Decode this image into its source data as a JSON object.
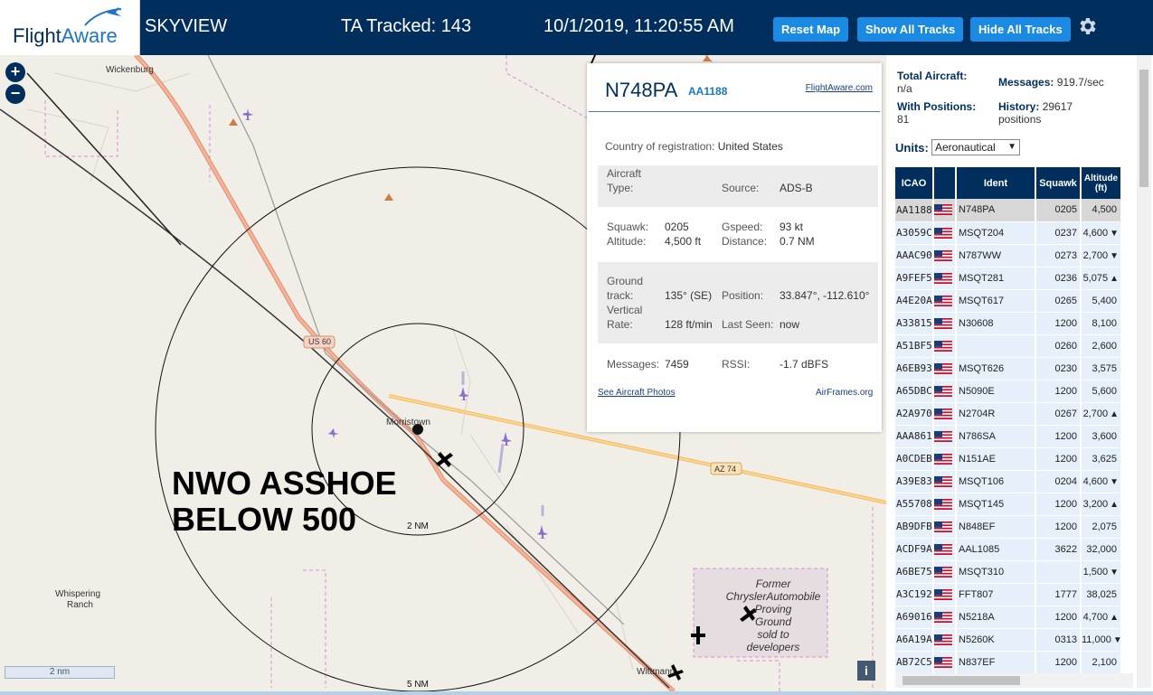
{
  "header": {
    "logo_flight": "Flight",
    "logo_aware": "Aware",
    "title": "SKYVIEW",
    "tracked": "TA Tracked: 143",
    "datetime": "10/1/2019, 11:20:55 AM",
    "btn_reset": "Reset Map",
    "btn_show": "Show All Tracks",
    "btn_hide": "Hide All Tracks"
  },
  "map": {
    "zoom_in": "+",
    "zoom_out": "−",
    "scale": "2 nm",
    "info": "i",
    "labels": {
      "wickenburg": "Wickenburg",
      "us60": "US 60",
      "az74": "AZ 74",
      "morristown": "Morristown",
      "whispering1": "Whispering",
      "whispering2": "Ranch",
      "wittmann": "Wittmann",
      "ring2": "2 NM",
      "ring5": "5 NM"
    },
    "overlay_line1": "NWO ASSHOE",
    "overlay_line2": "BELOW 500",
    "chrysler_lines": [
      "Former",
      "ChryslerAutomobile",
      "Proving",
      "Ground",
      "sold to",
      "developers"
    ]
  },
  "popup": {
    "registration": "N748PA",
    "ident": "AA1188",
    "fa_link": "FlightAware.com",
    "country_label": "Country of registration:",
    "country": "United States",
    "aircraft_label": "Aircraft",
    "type_label": "Type:",
    "source_label": "Source:",
    "source": "ADS-B",
    "squawk_label": "Squawk:",
    "squawk": "0205",
    "altitude_label": "Altitude:",
    "altitude": "4,500 ft",
    "gspeed_label": "Gspeed:",
    "gspeed": "93 kt",
    "distance_label": "Distance:",
    "distance": "0.7 NM",
    "ground_label": "Ground",
    "track_label": "track:",
    "track": "135° (SE)",
    "vertical_label": "Vertical",
    "rate_label": "Rate:",
    "rate": "128 ft/min",
    "position_label": "Position:",
    "position": "33.847°, -112.610°",
    "lastseen_label": "Last Seen:",
    "lastseen": "now",
    "messages_label": "Messages:",
    "messages": "7459",
    "rssi_label": "RSSI:",
    "rssi": "-1.7 dBFS",
    "photos_link": "See Aircraft Photos",
    "airframes_link": "AirFrames.org"
  },
  "sidebar": {
    "total_label": "Total Aircraft:",
    "total": "n/a",
    "messages_label": "Messages:",
    "messages": "919.7/sec",
    "withpos_label": "With Positions:",
    "withpos": "81",
    "history_label": "History:",
    "history": "29617",
    "history_unit": "positions",
    "units_label": "Units:",
    "units": "Aeronautical",
    "columns": [
      "ICAO",
      "",
      "Ident",
      "Squawk",
      "Altitude (ft)",
      ""
    ],
    "rows": [
      {
        "icao": "AA1188",
        "ident": "N748PA",
        "squawk": "0205",
        "alt": "4,500",
        "trend": ""
      },
      {
        "icao": "A3059C",
        "ident": "MSQT204",
        "squawk": "0237",
        "alt": "4,600",
        "trend": "▼"
      },
      {
        "icao": "AAAC90",
        "ident": "N787WW",
        "squawk": "0273",
        "alt": "2,700",
        "trend": "▼"
      },
      {
        "icao": "A9FEF5",
        "ident": "MSQT281",
        "squawk": "0236",
        "alt": "5,075",
        "trend": "▲"
      },
      {
        "icao": "A4E20A",
        "ident": "MSQT617",
        "squawk": "0265",
        "alt": "5,400",
        "trend": ""
      },
      {
        "icao": "A33815",
        "ident": "N30608",
        "squawk": "1200",
        "alt": "8,100",
        "trend": ""
      },
      {
        "icao": "A51BF5",
        "ident": "",
        "squawk": "0260",
        "alt": "2,600",
        "trend": ""
      },
      {
        "icao": "A6EB93",
        "ident": "MSQT626",
        "squawk": "0230",
        "alt": "3,575",
        "trend": ""
      },
      {
        "icao": "A65DBC",
        "ident": "N5090E",
        "squawk": "1200",
        "alt": "5,600",
        "trend": ""
      },
      {
        "icao": "A2A970",
        "ident": "N2704R",
        "squawk": "0267",
        "alt": "2,700",
        "trend": "▲"
      },
      {
        "icao": "AAA861",
        "ident": "N786SA",
        "squawk": "1200",
        "alt": "3,600",
        "trend": ""
      },
      {
        "icao": "A0CDEB",
        "ident": "N151AE",
        "squawk": "1200",
        "alt": "3,625",
        "trend": ""
      },
      {
        "icao": "A39E83",
        "ident": "MSQT106",
        "squawk": "0204",
        "alt": "4,600",
        "trend": "▼"
      },
      {
        "icao": "A55708",
        "ident": "MSQT145",
        "squawk": "1200",
        "alt": "3,200",
        "trend": "▲"
      },
      {
        "icao": "AB9DFB",
        "ident": "N848EF",
        "squawk": "1200",
        "alt": "2,075",
        "trend": ""
      },
      {
        "icao": "ACDF9A",
        "ident": "AAL1085",
        "squawk": "3622",
        "alt": "32,000",
        "trend": ""
      },
      {
        "icao": "A6BE75",
        "ident": "MSQT310",
        "squawk": "",
        "alt": "1,500",
        "trend": "▼"
      },
      {
        "icao": "A3C192",
        "ident": "FFT807",
        "squawk": "1777",
        "alt": "38,025",
        "trend": ""
      },
      {
        "icao": "A69016",
        "ident": "N5218A",
        "squawk": "1200",
        "alt": "4,700",
        "trend": "▲"
      },
      {
        "icao": "A6A19A",
        "ident": "N5260K",
        "squawk": "0313",
        "alt": "11,000",
        "trend": "▼"
      },
      {
        "icao": "AB72C5",
        "ident": "N837EF",
        "squawk": "1200",
        "alt": "2,100",
        "trend": ""
      }
    ]
  },
  "colors": {
    "header_bg": "#002f5d",
    "button": "#1a8ae2",
    "map_bg": "#f1eee8",
    "highway": "#f0a070",
    "state_route": "#f5b95a",
    "aircraft_tracked": "#8a6fd0"
  }
}
